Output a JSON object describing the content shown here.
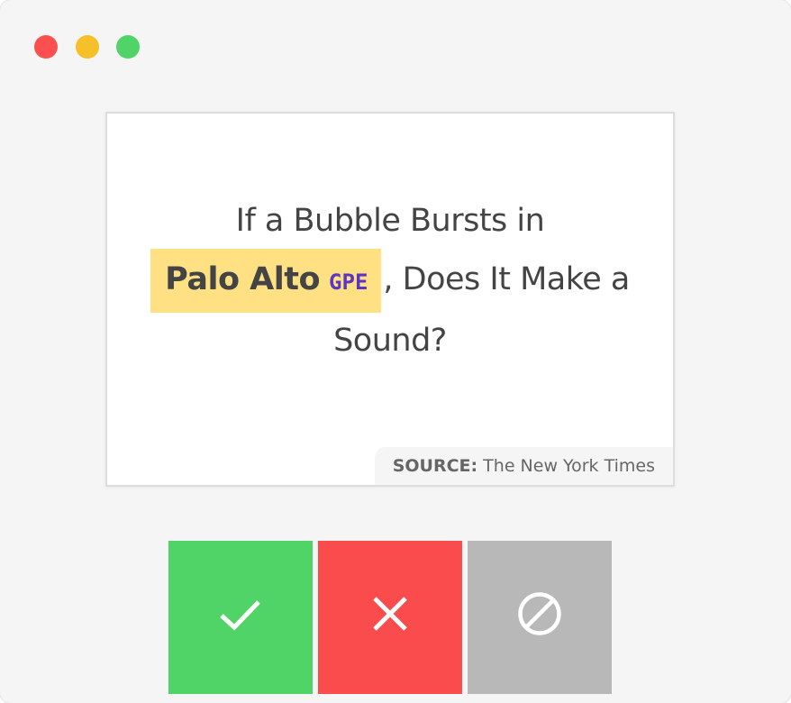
{
  "window": {
    "traffic_lights": {
      "close_color": "#fc5050",
      "minimize_color": "#f5c02a",
      "maximize_color": "#51d467"
    }
  },
  "card": {
    "text_before": "If a Bubble Bursts in",
    "entity": {
      "text": "Palo Alto",
      "label": "GPE",
      "highlight_color": "#ffe184",
      "label_color": "#5b35c4"
    },
    "text_after": ", Does It Make a Sound?",
    "source": {
      "label": "SOURCE:",
      "value": "The New York Times"
    }
  },
  "actions": {
    "accept": {
      "icon": "checkmark-icon",
      "color": "#51d467"
    },
    "reject": {
      "icon": "x-icon",
      "color": "#fa4c4c"
    },
    "ignore": {
      "icon": "no-entry-icon",
      "color": "#b8b8b8"
    }
  }
}
